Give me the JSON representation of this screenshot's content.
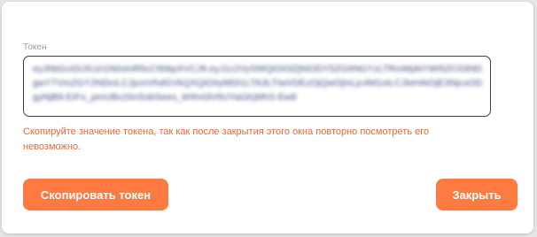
{
  "dialog": {
    "field_label": "Токен",
    "token_value": "eyJhbGciOiJIUzI1NiIsInR5cCI6IkpXVCJ9.eyJ1c2VySWQiOiI3ZjNiODY5ZGItNGYzLTRmMjAtYWI5ZC03NDgwYTVmZGY2NDciLCJjcmVhdGVkQXQiOiIyMDI1LTA3LTIwVDEzOjQwOjIxLjc4M1oiLCJleHAiOjE3NjcxODgyNjB9.EIFo_pmUBv20nSobSeeo_khfmt3V6UYaGKjMhS-Ew8",
    "warning_text": "Скопируйте значение токена, так как после закрытия этого окна повторно посмотреть его невозможно.",
    "copy_button_label": "Скопировать токен",
    "close_button_label": "Закрыть"
  },
  "colors": {
    "accent": "#ff7a40",
    "warning": "#e8683c",
    "border": "#3a3d57"
  }
}
